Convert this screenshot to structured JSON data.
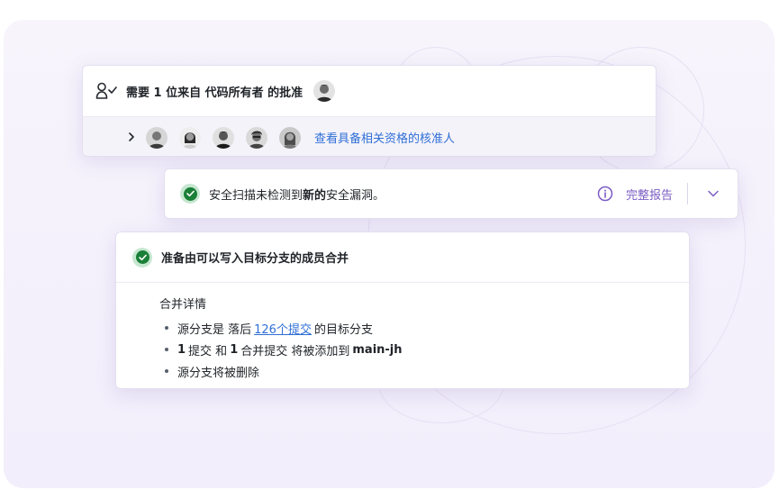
{
  "approval": {
    "title": "需要 1 位来自 代码所有者 的批准",
    "reviewers_link": "查看具备相关资格的核准人"
  },
  "security": {
    "text_before": "安全扫描未检测到",
    "text_bold": "新的",
    "text_after": "安全漏洞。",
    "report_link": "完整报告"
  },
  "merge": {
    "title": "准备由可以写入目标分支的成员合并",
    "details_label": "合并详情",
    "bullet1_before": "源分支是 落后",
    "bullet1_link": "126个提交",
    "bullet1_after": "的目标分支",
    "bullet2_num1": "1",
    "bullet2_mid": "提交 和",
    "bullet2_num2": "1",
    "bullet2_after": "合并提交 将被添加到",
    "bullet2_branch": "main-jh",
    "bullet3": "源分支将被删除"
  },
  "icons": {
    "approvers": "user-check-icon",
    "expand": "chevron-right-icon",
    "status": "check-circle-icon",
    "info": "info-icon",
    "collapse": "chevron-down-icon"
  },
  "colors": {
    "accent_purple": "#7b5cc4",
    "link_blue": "#2f6fd6",
    "success_green": "#1a7f37",
    "background": "#f4f0fb"
  }
}
